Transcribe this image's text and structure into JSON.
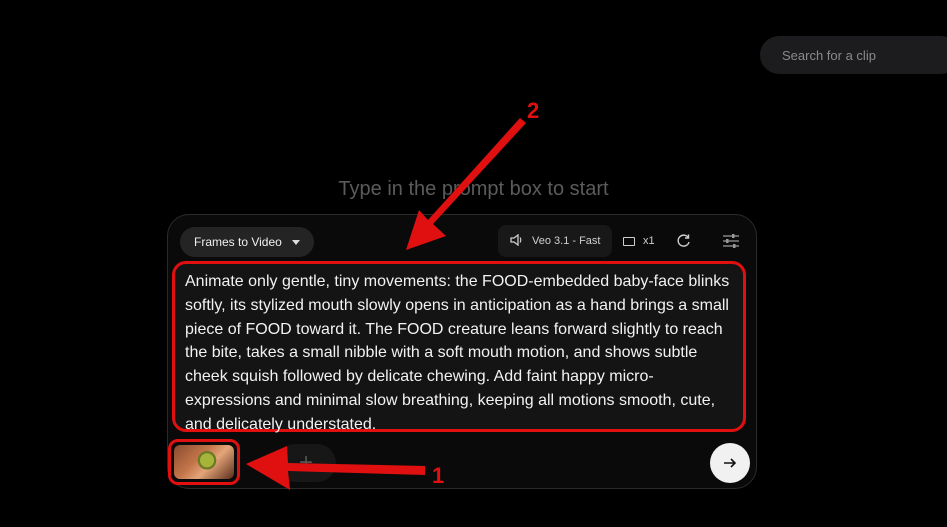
{
  "search": {
    "placeholder": "Search for a clip"
  },
  "hint": "Type in the prompt box to start",
  "toolbar": {
    "mode_label": "Frames to Video",
    "model_label": "Veo 3.1 - Fast",
    "output_count": "x1"
  },
  "prompt": {
    "text": "Animate only gentle, tiny movements: the FOOD-embedded baby-face blinks softly, its stylized mouth slowly opens in anticipation as a hand brings a small piece of FOOD toward it. The FOOD creature leans forward slightly to reach the bite, takes a small nibble with a soft mouth motion, and shows subtle cheek squish followed by delicate chewing. Add faint happy micro-expressions and minimal slow breathing, keeping all motions smooth, cute, and delicately understated."
  },
  "annotations": {
    "marker_1": "1",
    "marker_2": "2"
  },
  "colors": {
    "highlight": "#e01010",
    "background": "#000000"
  }
}
